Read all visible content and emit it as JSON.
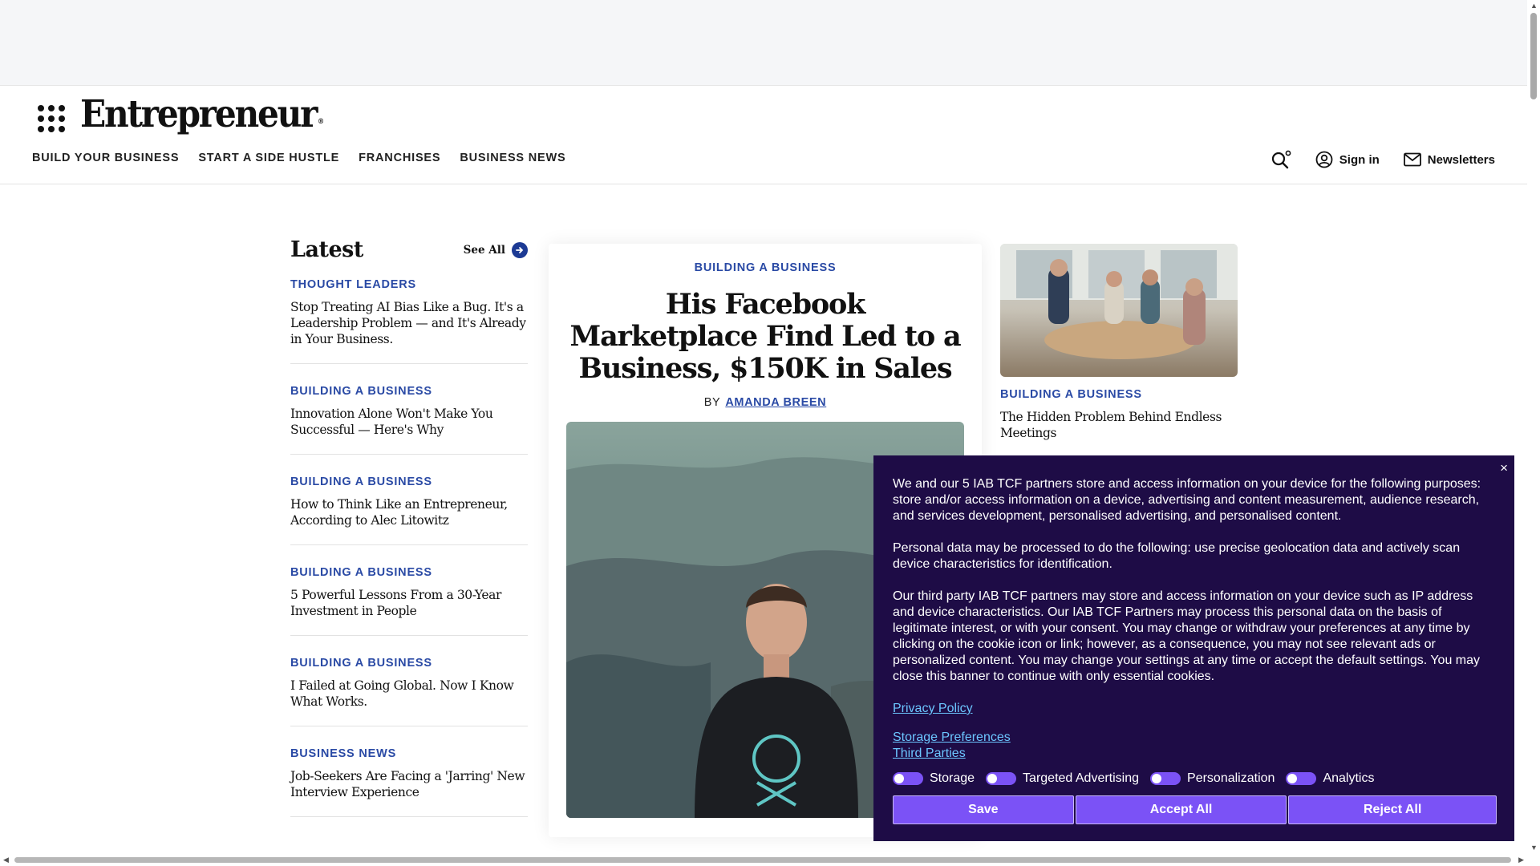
{
  "header": {
    "logo": "Entrepreneur",
    "logo_mark": "®",
    "nav": [
      "BUILD YOUR BUSINESS",
      "START A SIDE HUSTLE",
      "FRANCHISES",
      "BUSINESS NEWS"
    ],
    "sign_in": "Sign in",
    "newsletters": "Newsletters"
  },
  "latest": {
    "title": "Latest",
    "see_all": "See All",
    "items": [
      {
        "category": "THOUGHT LEADERS",
        "title": "Stop Treating AI Bias Like a Bug. It's a Leadership Problem — and It's Already in Your Business."
      },
      {
        "category": "BUILDING A BUSINESS",
        "title": "Innovation Alone Won't Make You Successful — Here's Why"
      },
      {
        "category": "BUILDING A BUSINESS",
        "title": "How to Think Like an Entrepreneur, According to Alec Litowitz"
      },
      {
        "category": "BUILDING A BUSINESS",
        "title": "5 Powerful Lessons From a 30-Year Investment in People"
      },
      {
        "category": "BUILDING A BUSINESS",
        "title": "I Failed at Going Global. Now I Know What Works."
      },
      {
        "category": "BUSINESS NEWS",
        "title": "Job-Seekers Are Facing a 'Jarring' New Interview Experience"
      }
    ]
  },
  "feature": {
    "category": "BUILDING A BUSINESS",
    "title": "His Facebook Marketplace Find Led to a Business, $150K in Sales",
    "by": "BY",
    "author": "AMANDA BREEN"
  },
  "side": {
    "category": "BUILDING A BUSINESS",
    "title": "The Hidden Problem Behind Endless Meetings"
  },
  "consent": {
    "close": "×",
    "p1": "We and our 5 IAB TCF partners store and access information on your device for the following purposes: store and/or access information on a device, advertising and content measurement, audience research, and services development, personalised advertising, and personalised content.",
    "p2": "Personal data may be processed to do the following: use precise geolocation data and actively scan device characteristics for identification.",
    "p3": "Our third party IAB TCF partners may store and access information on your device such as IP address and device characteristics. Our IAB TCF Partners may process this personal data on the basis of legitimate interest, or with your consent. You may change or withdraw your preferences at any time by clicking on the cookie icon or link; however, as a consequence, you may not see relevant ads or personalized content. You may change your settings at any time or accept the default settings. You may close this banner to continue with only essential cookies.",
    "privacy_policy": "Privacy Policy",
    "storage_preferences": "Storage Preferences",
    "third_parties": "Third Parties",
    "toggles": [
      "Storage",
      "Targeted Advertising",
      "Personalization",
      "Analytics"
    ],
    "buttons": {
      "save": "Save",
      "accept": "Accept All",
      "reject": "Reject All"
    }
  },
  "colors": {
    "accent_blue": "#2a4aa5",
    "consent_bg": "#1e0c46",
    "consent_button": "#7b52f6",
    "consent_link": "#6cc6ff"
  }
}
